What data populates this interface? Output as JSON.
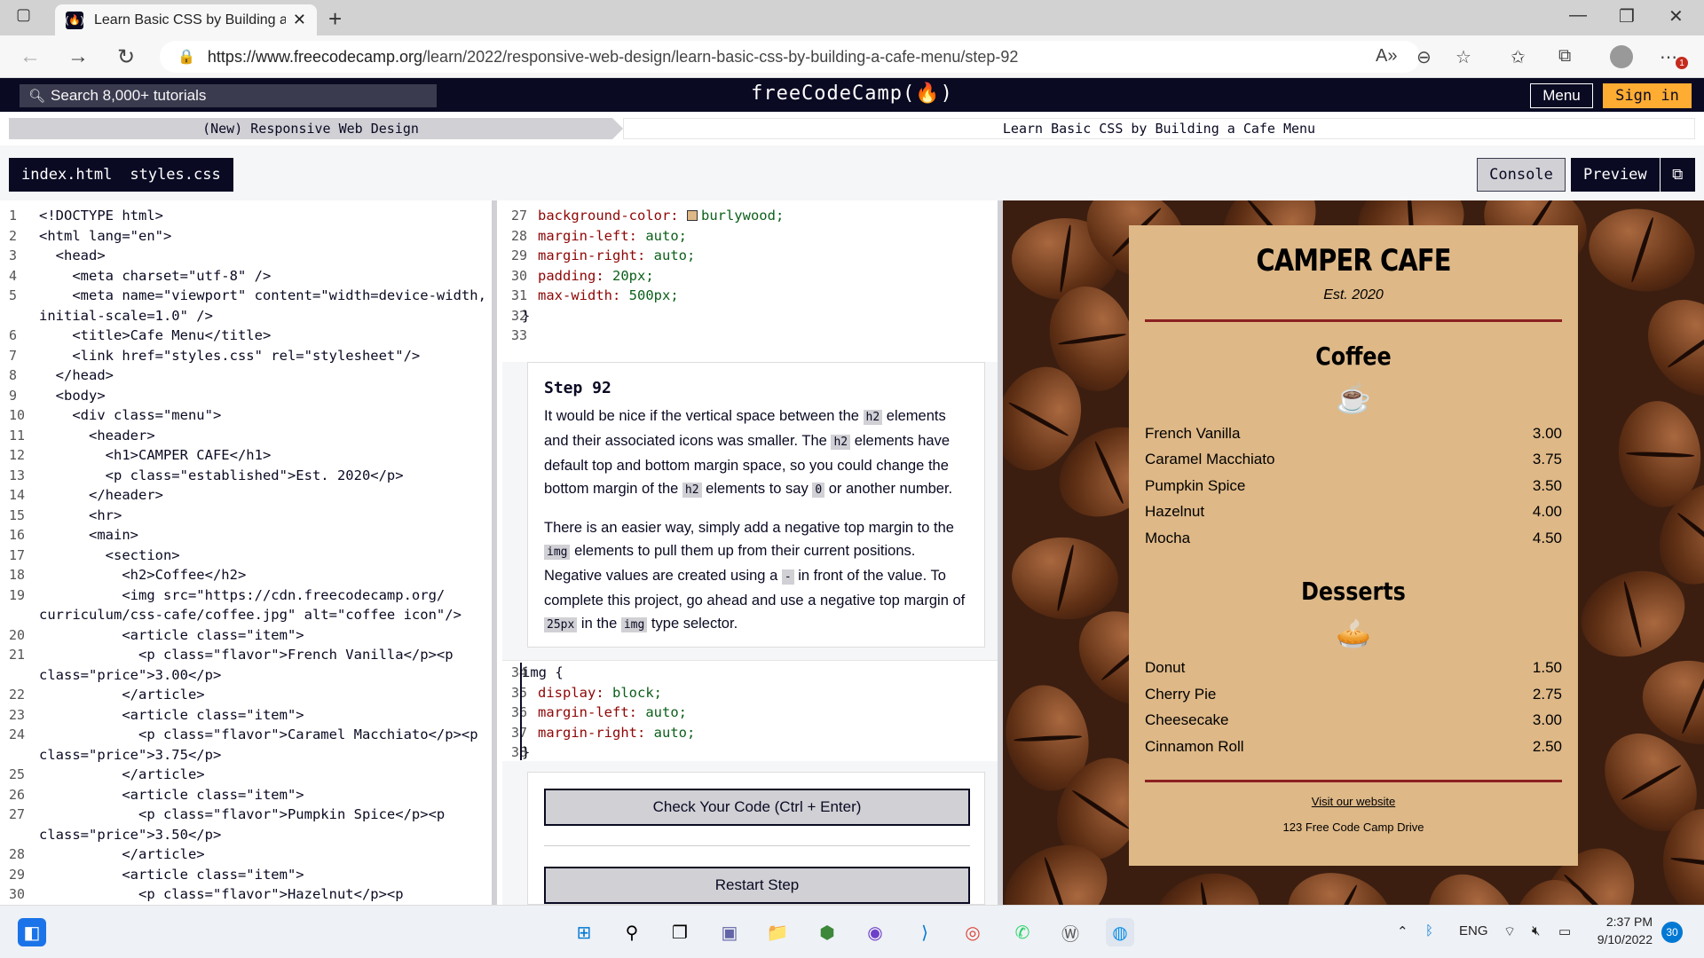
{
  "browser": {
    "tab_title": "Learn Basic CSS by Building a Ca",
    "url_host": "https://www.freecodecamp.org",
    "url_path": "/learn/2022/responsive-web-design/learn-basic-css-by-building-a-cafe-menu/step-92",
    "notification_count": "1"
  },
  "fcc": {
    "search_placeholder": "Search 8,000+ tutorials",
    "logo": "freeCodeCamp(🔥)",
    "menu_label": "Menu",
    "signin_label": "Sign in",
    "breadcrumb_cert": "(New) Responsive Web Design",
    "breadcrumb_project": "Learn Basic CSS by Building a Cafe Menu",
    "file_tabs": [
      "index.html",
      "styles.css"
    ],
    "console_label": "Console",
    "preview_label": "Preview"
  },
  "html_code": {
    "line_numbers": [
      "1",
      "2",
      "3",
      "4",
      "5",
      "",
      "6",
      "7",
      "8",
      "9",
      "10",
      "11",
      "12",
      "13",
      "14",
      "15",
      "16",
      "17",
      "18",
      "19",
      "",
      "20",
      "21",
      "",
      "22",
      "23",
      "24",
      "",
      "25",
      "26",
      "27",
      "",
      "28",
      "29",
      "30"
    ],
    "lines": [
      "<!DOCTYPE html>",
      "<html lang=\"en\">",
      "  <head>",
      "    <meta charset=\"utf-8\" />",
      "    <meta name=\"viewport\" content=\"width=device-width,",
      "initial-scale=1.0\" />",
      "    <title>Cafe Menu</title>",
      "    <link href=\"styles.css\" rel=\"stylesheet\"/>",
      "  </head>",
      "  <body>",
      "    <div class=\"menu\">",
      "      <header>",
      "        <h1>CAMPER CAFE</h1>",
      "        <p class=\"established\">Est. 2020</p>",
      "      </header>",
      "      <hr>",
      "      <main>",
      "        <section>",
      "          <h2>Coffee</h2>",
      "          <img src=\"https://cdn.freecodecamp.org/",
      "curriculum/css-cafe/coffee.jpg\" alt=\"coffee icon\"/>",
      "          <article class=\"item\">",
      "            <p class=\"flavor\">French Vanilla</p><p",
      "class=\"price\">3.00</p>",
      "          </article>",
      "          <article class=\"item\">",
      "            <p class=\"flavor\">Caramel Macchiato</p><p",
      "class=\"price\">3.75</p>",
      "          </article>",
      "          <article class=\"item\">",
      "            <p class=\"flavor\">Pumpkin Spice</p><p",
      "class=\"price\">3.50</p>",
      "          </article>",
      "          <article class=\"item\">",
      "            <p class=\"flavor\">Hazelnut</p><p"
    ]
  },
  "css_code": {
    "top_lines": [
      {
        "n": "27",
        "prop": "background-color:",
        "val": "burlywood;",
        "swatch": "#deb887"
      },
      {
        "n": "28",
        "prop": "margin-left:",
        "val": "auto;"
      },
      {
        "n": "29",
        "prop": "margin-right:",
        "val": "auto;"
      },
      {
        "n": "30",
        "prop": "padding:",
        "val": "20px;"
      },
      {
        "n": "31",
        "prop": "max-width:",
        "val": "500px;"
      },
      {
        "n": "32",
        "prop": "}",
        "val": ""
      },
      {
        "n": "33",
        "prop": "",
        "val": ""
      }
    ],
    "bottom_lines": [
      {
        "n": "34",
        "text": "img {"
      },
      {
        "n": "35",
        "prop": "display:",
        "val": "block;"
      },
      {
        "n": "36",
        "prop": "margin-left:",
        "val": "auto;"
      },
      {
        "n": "37",
        "prop": "margin-right:",
        "val": "auto;"
      },
      {
        "n": "38",
        "text": "}"
      }
    ]
  },
  "step": {
    "title": "Step 92",
    "p1_parts": [
      "It would be nice if the vertical space between the ",
      "h2",
      " elements and their associated icons was smaller. The ",
      "h2",
      " elements have default top and bottom margin space, so you could change the bottom margin of the ",
      "h2",
      " elements to say ",
      "0",
      " or another number."
    ],
    "p2_parts": [
      "There is an easier way, simply add a negative top margin to the ",
      "img",
      " elements to pull them up from their current positions. Negative values are created using a ",
      "-",
      " in front of the value. To complete this project, go ahead and use a negative top margin of ",
      "25px",
      " in the ",
      "img",
      " type selector."
    ],
    "check_label": "Check Your Code (Ctrl + Enter)",
    "restart_label": "Restart Step"
  },
  "cafe": {
    "title": "CAMPER CAFE",
    "established": "Est. 2020",
    "sections": [
      {
        "name": "Coffee",
        "icon": "coffee-cup-icon",
        "items": [
          {
            "flavor": "French Vanilla",
            "price": "3.00"
          },
          {
            "flavor": "Caramel Macchiato",
            "price": "3.75"
          },
          {
            "flavor": "Pumpkin Spice",
            "price": "3.50"
          },
          {
            "flavor": "Hazelnut",
            "price": "4.00"
          },
          {
            "flavor": "Mocha",
            "price": "4.50"
          }
        ]
      },
      {
        "name": "Desserts",
        "icon": "pie-slice-icon",
        "items": [
          {
            "flavor": "Donut",
            "price": "1.50"
          },
          {
            "flavor": "Cherry Pie",
            "price": "2.75"
          },
          {
            "flavor": "Cheesecake",
            "price": "3.00"
          },
          {
            "flavor": "Cinnamon Roll",
            "price": "2.50"
          }
        ]
      }
    ],
    "website_link": "Visit our website",
    "address": "123 Free Code Camp Drive"
  },
  "taskbar": {
    "lang": "ENG",
    "time": "2:37 PM",
    "date": "9/10/2022",
    "badge": "30"
  },
  "colors": {
    "fcc_dark": "#0a0a23",
    "accent": "#feac32",
    "menu_bg": "#deb887",
    "rule": "#8b2020"
  }
}
